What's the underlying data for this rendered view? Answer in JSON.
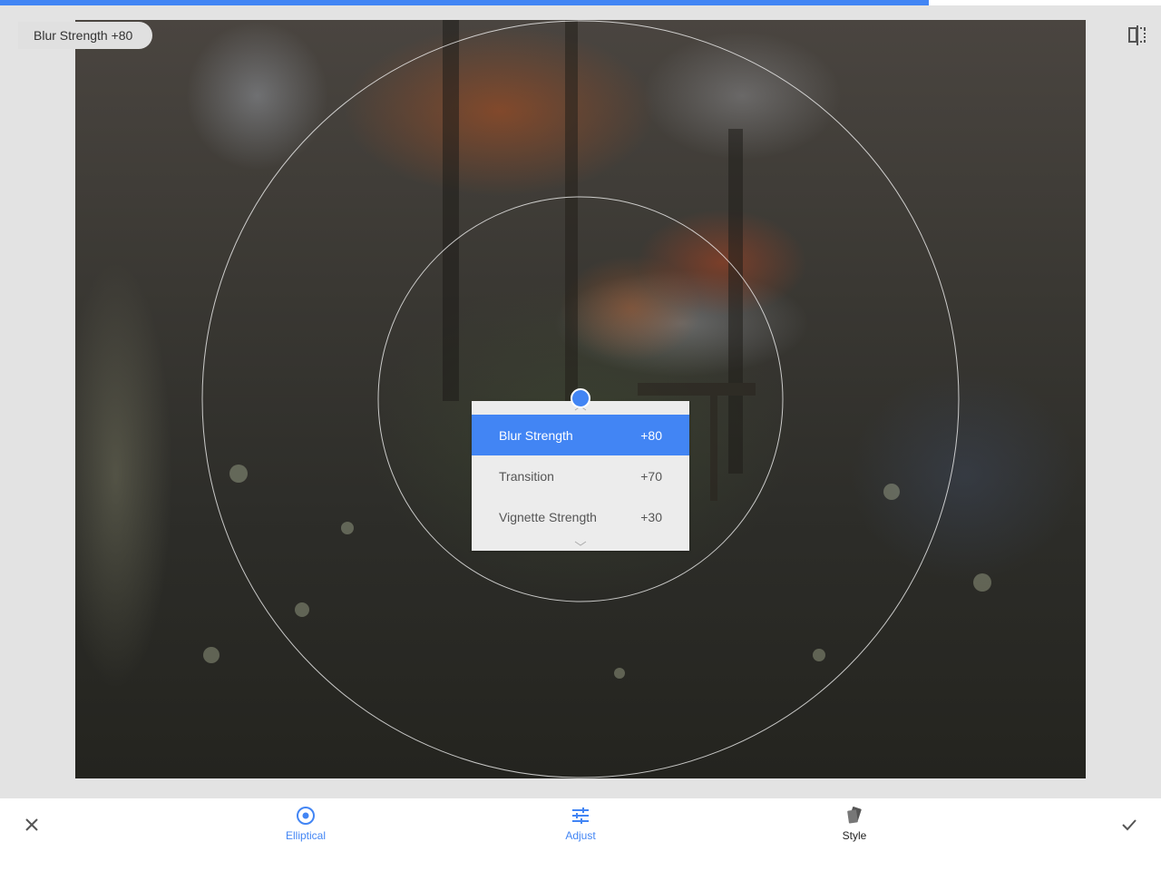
{
  "progress": {
    "fraction": 0.8
  },
  "badge": {
    "label": "Blur Strength +80"
  },
  "menu": {
    "items": [
      {
        "label": "Blur Strength",
        "value": "+80",
        "active": true
      },
      {
        "label": "Transition",
        "value": "+70",
        "active": false
      },
      {
        "label": "Vignette Strength",
        "value": "+30",
        "active": false
      }
    ]
  },
  "toolbar": {
    "elliptical_label": "Elliptical",
    "adjust_label": "Adjust",
    "style_label": "Style"
  },
  "colors": {
    "accent": "#4285f4",
    "active_tool": "#4285f4",
    "inactive_tool": "#222222",
    "panel": "#e3e3e3"
  },
  "icons": {
    "cancel": "close-icon",
    "apply": "check-icon",
    "compare": "compare-icon",
    "elliptical": "elliptical-icon",
    "adjust": "sliders-icon",
    "style": "style-icon"
  }
}
